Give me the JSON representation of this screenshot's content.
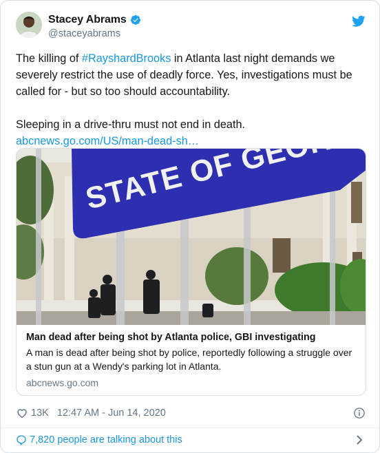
{
  "author": {
    "display_name": "Stacey Abrams",
    "handle": "@staceyabrams",
    "verified": true
  },
  "tweet": {
    "text_before_hashtag": "The killing of ",
    "hashtag": "#RayshardBrooks",
    "text_after_hashtag": " in Atlanta last night demands we severely restrict the use of deadly force. Yes,  investigations must be called for - but so too should accountability.",
    "paragraph_two": "Sleeping in a drive-thru must not end in death.",
    "link": "abcnews.go.com/US/man-dead-sh…"
  },
  "card": {
    "image_sign_text": "STATE OF GEORG",
    "title": "Man dead after being shot by Atlanta police, GBI investigating",
    "description": "A man is dead after being shot by police, reportedly following a struggle over a stun gun at a Wendy's parking lot in Atlanta.",
    "domain": "abcnews.go.com"
  },
  "meta": {
    "likes": "13K",
    "timestamp": "12:47 AM - Jun 14, 2020"
  },
  "conversation": {
    "label": "7,820 people are talking about this"
  },
  "colors": {
    "link": "#1b95e0",
    "muted": "#657786",
    "text": "#14171a",
    "sign_blue": "#2d2fb0"
  },
  "icons": {
    "verified": "verified-badge-icon",
    "brand": "twitter-bird-icon",
    "like": "heart-icon",
    "info": "info-icon",
    "conversation": "speech-bubble-icon",
    "expand": "chevron-right-icon"
  }
}
